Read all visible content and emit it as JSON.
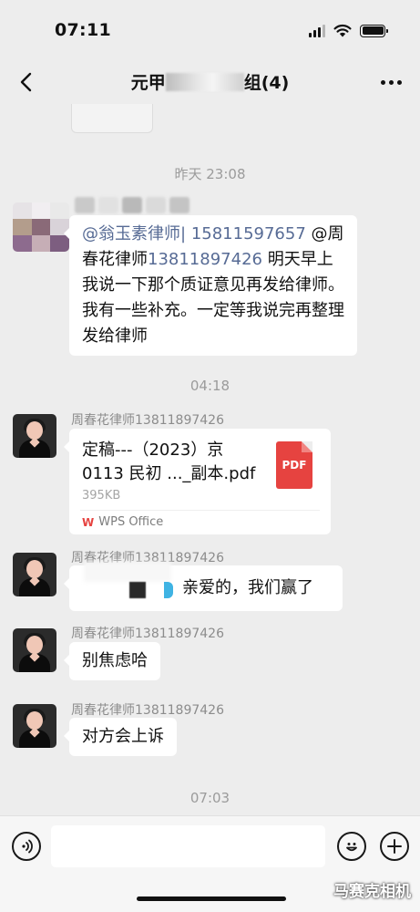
{
  "status": {
    "time": "07:11"
  },
  "nav": {
    "title_prefix": "元甲",
    "title_suffix": "组(4)"
  },
  "chat": {
    "time_1": "昨天 23:08",
    "msg1": {
      "mention1": "@翁玉素律师|",
      "phone1": "15811597657",
      "mention2_at": "@",
      "mention2_name": "周春花律师",
      "phone2": "13811897426",
      "text": "明天早上我说一下那个质证意见再发给律师。我有一些补充。一定等我说完再整理发给律师"
    },
    "time_2": "04:18",
    "sender_name": "周春花律师13811897426",
    "file": {
      "name": "定稿---（2023）京0113 民初 ..._副本.pdf",
      "size": "395KB",
      "icon_label": "PDF",
      "source": "WPS Office",
      "source_logo": "W"
    },
    "msg3_text": "亲爱的，我们赢了",
    "msg4_text": "别焦虑哈",
    "msg5_text": "对方会上诉",
    "time_3": "07:03"
  },
  "input": {
    "placeholder": ""
  },
  "watermark": "马赛克相机",
  "colors": {
    "background": "#ededed",
    "bubble": "#ffffff",
    "mention": "#576b95",
    "pdf": "#e64340"
  }
}
